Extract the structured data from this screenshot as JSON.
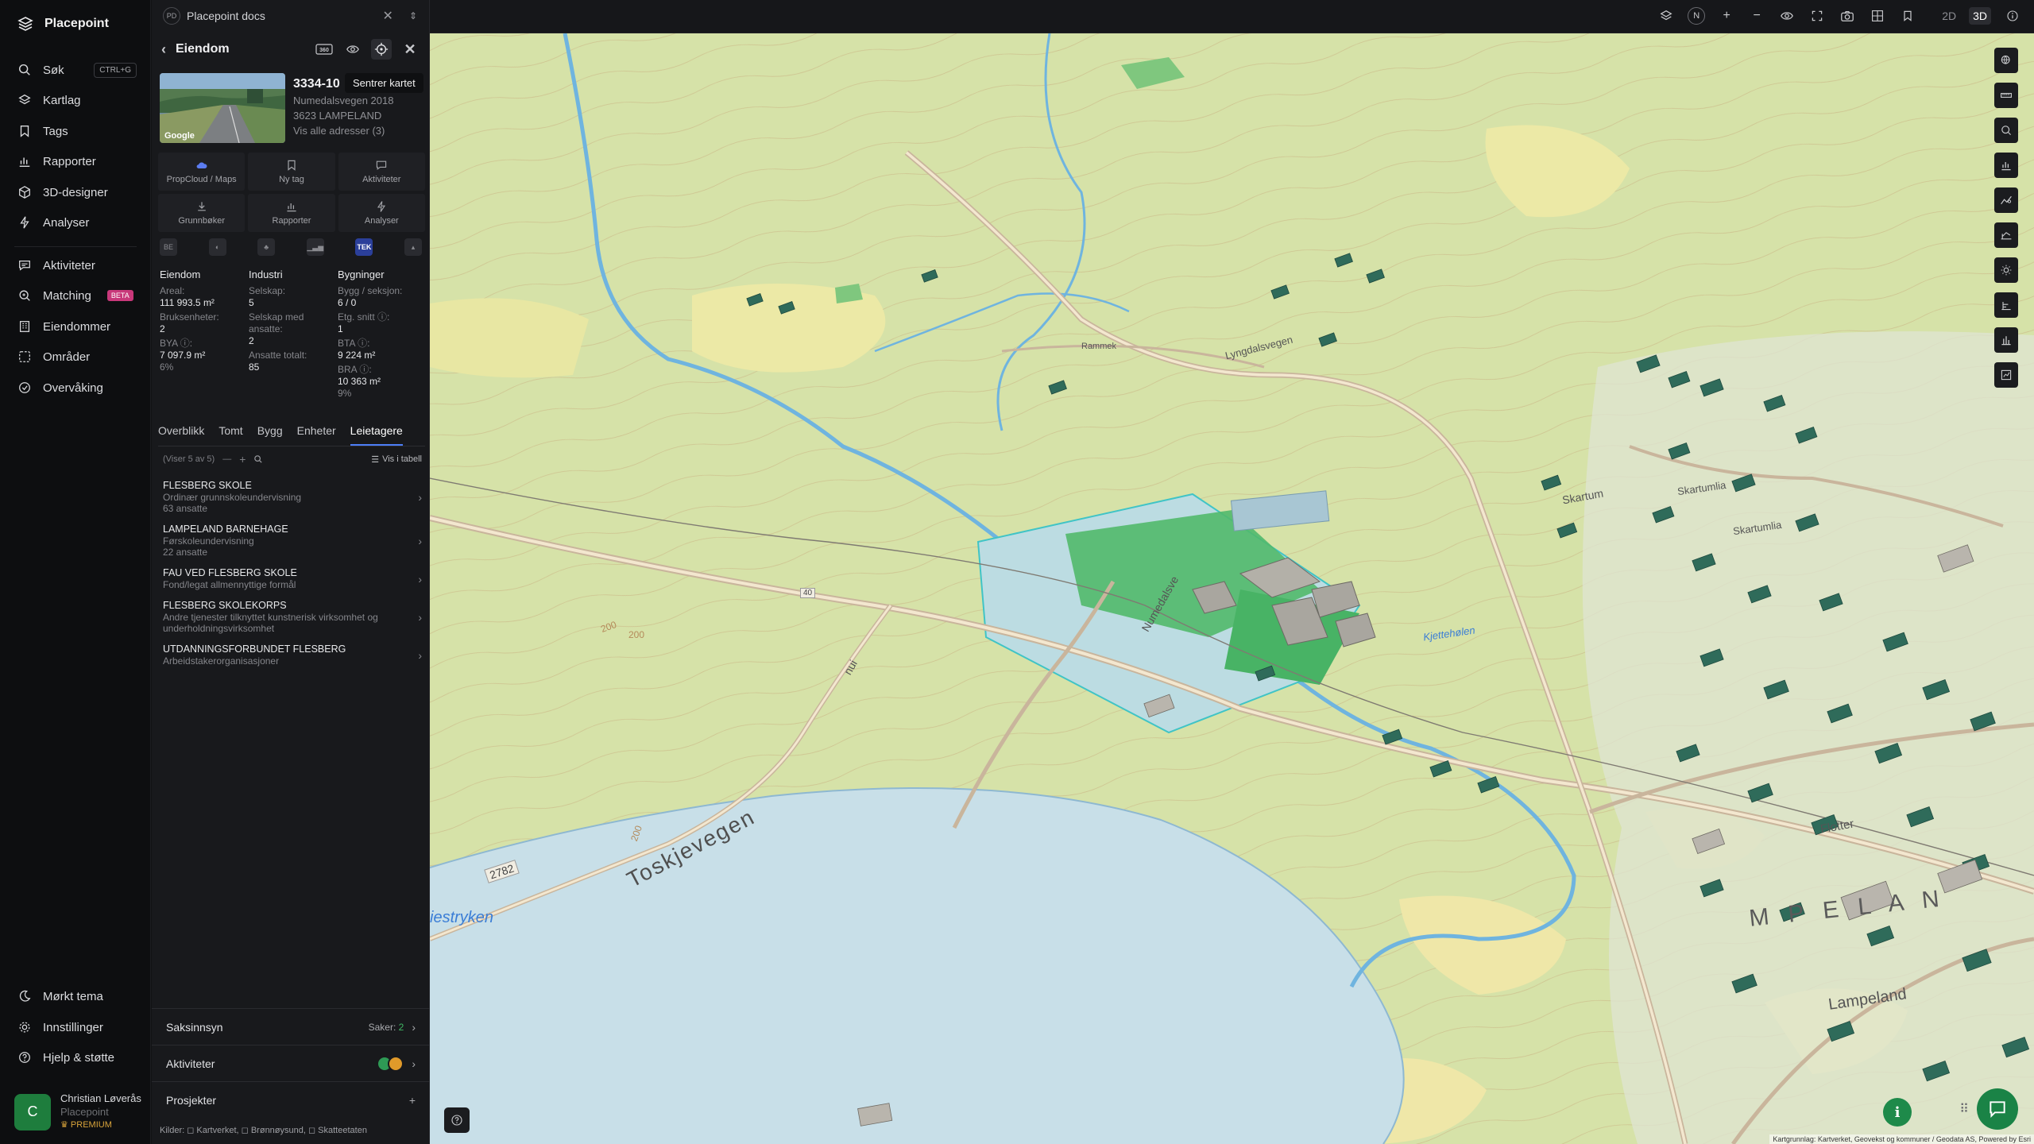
{
  "nav": {
    "brand": "Placepoint",
    "items": [
      {
        "label": "Søk",
        "icon": "search-icon",
        "shortcut": "CTRL+G"
      },
      {
        "label": "Kartlag",
        "icon": "layers-icon"
      },
      {
        "label": "Tags",
        "icon": "bookmark-icon"
      },
      {
        "label": "Rapporter",
        "icon": "bar-chart-icon"
      },
      {
        "label": "3D-designer",
        "icon": "cube-icon"
      },
      {
        "label": "Analyser",
        "icon": "bolt-icon"
      },
      {
        "label": "Aktiviteter",
        "icon": "chat-icon"
      },
      {
        "label": "Matching",
        "icon": "matching-icon",
        "badge": "BETA"
      },
      {
        "label": "Eiendommer",
        "icon": "building-icon"
      },
      {
        "label": "Områder",
        "icon": "area-icon"
      },
      {
        "label": "Overvåking",
        "icon": "monitor-icon"
      }
    ],
    "bottom": [
      {
        "label": "Mørkt tema",
        "icon": "moon-icon"
      },
      {
        "label": "Innstillinger",
        "icon": "gear-icon"
      },
      {
        "label": "Hjelp & støtte",
        "icon": "help-icon"
      }
    ],
    "user": {
      "initial": "C",
      "name": "Christian Løverås",
      "org": "Placepoint",
      "plan": "PREMIUM"
    }
  },
  "panel": {
    "doc_tab": {
      "badge": "PD",
      "title": "Placepoint docs"
    },
    "title": "Eiendom",
    "tooltip": "Sentrer kartet",
    "photo_label": "Google",
    "property": {
      "number": "3334-10",
      "address": "Numedalsvegen 2018",
      "postal": "3623 LAMPELAND",
      "all_addresses": "Vis alle adresser (3)"
    },
    "tiles": [
      {
        "label": "PropCloud / Maps",
        "icon": "cloud-icon"
      },
      {
        "label": "Ny tag",
        "icon": "bookmark-icon"
      },
      {
        "label": "Aktiviteter",
        "icon": "chat-icon"
      },
      {
        "label": "Grunnbøker",
        "icon": "download-icon"
      },
      {
        "label": "Rapporter",
        "icon": "bar-chart-icon"
      },
      {
        "label": "Analyser",
        "icon": "bolt-icon"
      }
    ],
    "indicators": [
      "BE",
      "",
      "",
      "",
      "TEK",
      ""
    ],
    "stats": {
      "eiendom": {
        "title": "Eiendom",
        "areal_label": "Areal:",
        "areal_value": "111 993.5 m²",
        "bruksenheter_label": "Bruksenheter:",
        "bruksenheter_value": "2",
        "bya_label": "BYA ⓘ:",
        "bya_value": "7 097.9 m²",
        "bya_pct": "6%"
      },
      "industri": {
        "title": "Industri",
        "selskap_label": "Selskap:",
        "selskap_value": "5",
        "ansatte_label": "Selskap med ansatte:",
        "ansatte_value": "2",
        "totalt_label": "Ansatte totalt:",
        "totalt_value": "85"
      },
      "bygninger": {
        "title": "Bygninger",
        "bygg_label": "Bygg / seksjon:",
        "bygg_value": "6 / 0",
        "etg_label": "Etg. snitt ⓘ:",
        "etg_value": "1",
        "bta_label": "BTA ⓘ:",
        "bta_value": "9 224 m²",
        "bra_label": "BRA ⓘ:",
        "bra_value": "10 363 m²",
        "bra_pct": "9%"
      }
    },
    "tabs": [
      "Overblikk",
      "Tomt",
      "Bygg",
      "Enheter",
      "Leietagere"
    ],
    "active_tab": "Leietagere",
    "list": {
      "count": "(Viser 5 av 5)",
      "table_label": "Vis i tabell",
      "items": [
        {
          "name": "FLESBERG SKOLE",
          "desc": "Ordinær grunnskoleundervisning",
          "extra": "63 ansatte"
        },
        {
          "name": "LAMPELAND BARNEHAGE",
          "desc": "Førskoleundervisning",
          "extra": "22 ansatte"
        },
        {
          "name": "FAU VED FLESBERG SKOLE",
          "desc": "Fond/legat allmennyttige formål",
          "extra": ""
        },
        {
          "name": "FLESBERG SKOLEKORPS",
          "desc": "Andre tjenester tilknyttet kunstnerisk virksomhet og underholdningsvirksomhet",
          "extra": ""
        },
        {
          "name": "UTDANNINGSFORBUNDET FLESBERG",
          "desc": "Arbeidstakerorganisasjoner",
          "extra": ""
        }
      ]
    },
    "accordions": {
      "saksinnsyn": {
        "label": "Saksinnsyn",
        "count_label": "Saker:",
        "count": "2"
      },
      "aktiviteter": {
        "label": "Aktiviteter"
      },
      "prosjekter": {
        "label": "Prosjekter"
      }
    },
    "sources": "Kilder: ◻ Kartverket, ◻ Brønnøysund, ◻ Skatteetaten"
  },
  "topbar": {
    "compass": "N",
    "mode_2d": "2D",
    "mode_3d": "3D"
  },
  "map": {
    "labels": {
      "lyngdalsvegen": "Lyngdalsvegen",
      "skartum": "Skartum",
      "skartumlia": "Skartumlia",
      "skartumlia2": "Skartumlia",
      "numedalsvegen": "Numedalsve",
      "toskjevegen": "Toskjevegen",
      "road_2782": "2782",
      "road_40": "40",
      "kjettehølen": "Kjettehølen",
      "iestryken": "iestryken",
      "lampeland": "Lampeland",
      "lampeland_big": "M P E L A N",
      "flotter": "Flotter",
      "rammek": "Rammek",
      "elev200": "200",
      "elev200b": "200",
      "elev200c": "200",
      "nui": "nui"
    },
    "attribution": "Kartgrunnlag: Kartverket, Geovekst og kommuner / Geodata AS, Powered by Esri"
  },
  "colors": {
    "accent": "#4d7ef7",
    "green": "#1e8a4a",
    "beta": "#c8387a"
  }
}
